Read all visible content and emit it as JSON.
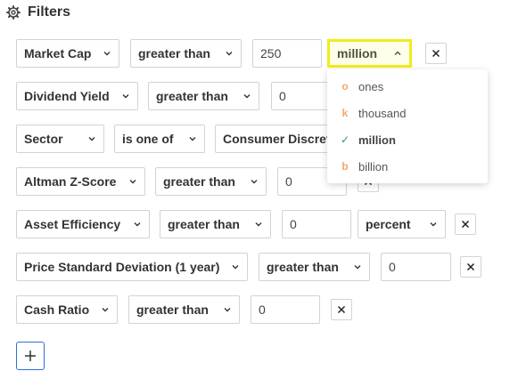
{
  "header": {
    "title": "Filters"
  },
  "rows": [
    {
      "field": "Market Cap",
      "operator": "greater than",
      "value": "250",
      "unit": "million"
    },
    {
      "field": "Dividend Yield",
      "operator": "greater than",
      "value": "0"
    },
    {
      "field": "Sector",
      "operator": "is one of",
      "value": "Consumer Discretionary"
    },
    {
      "field": "Altman Z-Score",
      "operator": "greater than",
      "value": "0"
    },
    {
      "field": "Asset Efficiency",
      "operator": "greater than",
      "value": "0",
      "unit": "percent"
    },
    {
      "field": "Price Standard Deviation (1 year)",
      "operator": "greater than",
      "value": "0"
    },
    {
      "field": "Cash Ratio",
      "operator": "greater than",
      "value": "0"
    }
  ],
  "unit_menu": {
    "items": [
      {
        "marker": "o",
        "label": "ones"
      },
      {
        "marker": "k",
        "label": "thousand"
      },
      {
        "marker": "✓",
        "label": "million",
        "selected": true
      },
      {
        "marker": "b",
        "label": "billion"
      }
    ]
  },
  "colors": {
    "highlight": "#f2ec1c",
    "accent": "#2f6fd6",
    "check": "#22a45d",
    "marker": "#f2a86b"
  },
  "icons": {
    "header": "gear-icon",
    "dropdown": "chevron-down-icon",
    "dropdown_open": "chevron-up-icon",
    "remove": "close-icon",
    "add": "plus-icon"
  }
}
